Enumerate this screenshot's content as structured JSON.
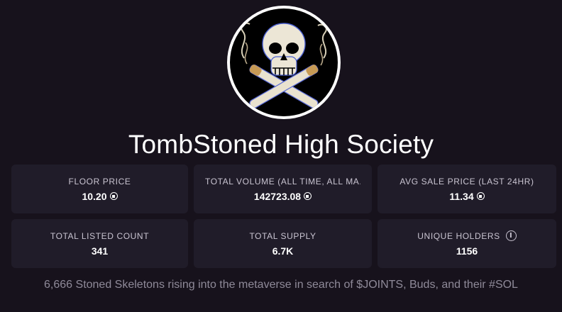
{
  "collection": {
    "name": "TombStoned High Society",
    "avatar_icon": "skull-crossed-joints-icon",
    "description": "6,666 Stoned Skeletons rising into the metaverse in search of $JOINTS, Buds, and their #SOL"
  },
  "stats": [
    {
      "label": "FLOOR PRICE",
      "value": "10.20",
      "currency_icon": "sol-icon"
    },
    {
      "label": "TOTAL VOLUME (ALL TIME, ALL MA...",
      "value": "142723.08",
      "currency_icon": "sol-icon"
    },
    {
      "label": "AVG SALE PRICE (LAST 24HR)",
      "value": "11.34",
      "currency_icon": "sol-icon"
    },
    {
      "label": "TOTAL LISTED COUNT",
      "value": "341"
    },
    {
      "label": "TOTAL SUPPLY",
      "value": "6.7K"
    },
    {
      "label": "UNIQUE HOLDERS",
      "value": "1156",
      "info_icon": "info-icon"
    }
  ],
  "colors": {
    "background": "#17121c",
    "card": "#201c29",
    "label": "#c9c4d1",
    "muted_text": "#8f8a99"
  }
}
